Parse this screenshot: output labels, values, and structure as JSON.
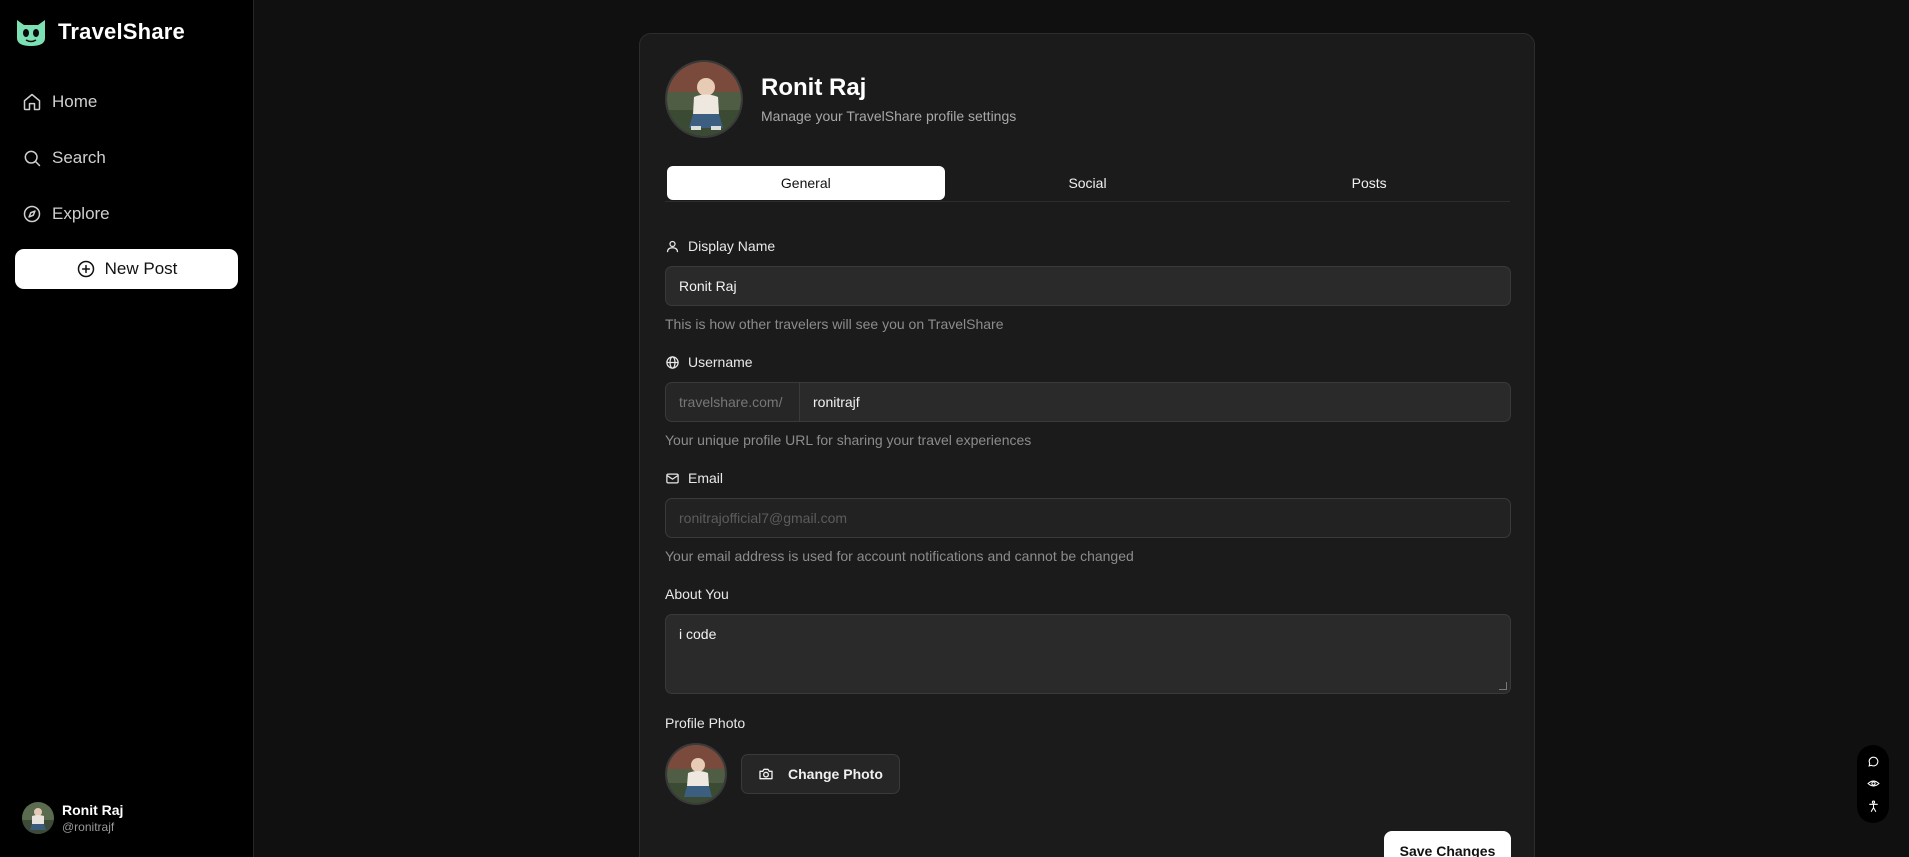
{
  "app": {
    "name": "TravelShare"
  },
  "sidebar": {
    "nav": [
      {
        "label": "Home",
        "icon": "home-icon"
      },
      {
        "label": "Search",
        "icon": "search-icon"
      },
      {
        "label": "Explore",
        "icon": "compass-icon"
      }
    ],
    "new_post_label": "New Post",
    "user": {
      "name": "Ronit Raj",
      "handle": "@ronitrajf"
    }
  },
  "profile": {
    "name": "Ronit Raj",
    "subtitle": "Manage your TravelShare profile settings"
  },
  "tabs": [
    {
      "label": "General",
      "active": true
    },
    {
      "label": "Social",
      "active": false
    },
    {
      "label": "Posts",
      "active": false
    }
  ],
  "form": {
    "display_name": {
      "label": "Display Name",
      "value": "Ronit Raj",
      "hint": "This is how other travelers will see you on TravelShare"
    },
    "username": {
      "label": "Username",
      "prefix": "travelshare.com/",
      "value": "ronitrajf",
      "hint": "Your unique profile URL for sharing your travel experiences"
    },
    "email": {
      "label": "Email",
      "value": "ronitrajofficial7@gmail.com",
      "hint": "Your email address is used for account notifications and cannot be changed"
    },
    "about": {
      "label": "About You",
      "value": "i code"
    },
    "photo": {
      "label": "Profile Photo",
      "button_label": "Change Photo"
    },
    "save_label": "Save Changes"
  },
  "colors": {
    "accent_logo": "#7de0b5",
    "background": "#101010",
    "card": "#1b1b1b"
  }
}
